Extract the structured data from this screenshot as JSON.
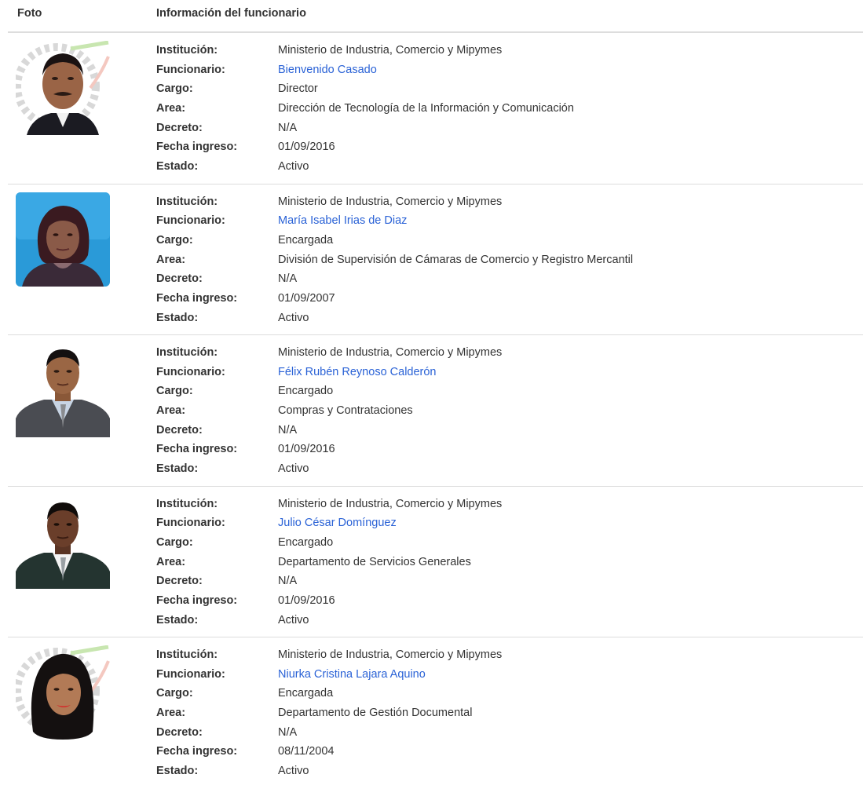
{
  "header": {
    "col_photo": "Foto",
    "col_info": "Información del funcionario"
  },
  "labels": {
    "institucion": "Institución:",
    "funcionario": "Funcionario:",
    "cargo": "Cargo:",
    "area": "Area:",
    "decreto": "Decreto:",
    "fecha": "Fecha ingreso:",
    "estado": "Estado:"
  },
  "officials": [
    {
      "institucion": "Ministerio de Industria, Comercio y Mipymes",
      "funcionario": "Bienvenido Casado",
      "cargo": "Director",
      "area": "Dirección de Tecnología de la Información y Comunicación",
      "decreto": "N/A",
      "fecha": "01/09/2016",
      "estado": "Activo"
    },
    {
      "institucion": "Ministerio de Industria, Comercio y Mipymes",
      "funcionario": "María Isabel Irias de Diaz",
      "cargo": "Encargada",
      "area": "División de Supervisión de Cámaras de Comercio y Registro Mercantil",
      "decreto": "N/A",
      "fecha": "01/09/2007",
      "estado": "Activo"
    },
    {
      "institucion": "Ministerio de Industria, Comercio y Mipymes",
      "funcionario": "Félix Rubén Reynoso Calderón",
      "cargo": "Encargado",
      "area": "Compras y Contrataciones",
      "decreto": "N/A",
      "fecha": "01/09/2016",
      "estado": "Activo"
    },
    {
      "institucion": "Ministerio de Industria, Comercio y Mipymes",
      "funcionario": "Julio César Domínguez",
      "cargo": "Encargado",
      "area": "Departamento de Servicios Generales",
      "decreto": "N/A",
      "fecha": "01/09/2016",
      "estado": "Activo"
    },
    {
      "institucion": "Ministerio de Industria, Comercio y Mipymes",
      "funcionario": "Niurka Cristina Lajara Aquino",
      "cargo": "Encargada",
      "area": "Departamento de Gestión Documental",
      "decreto": "N/A",
      "fecha": "08/11/2004",
      "estado": "Activo"
    }
  ],
  "colors": {
    "link": "#2a62d6",
    "text": "#333333",
    "border": "#dddddd"
  }
}
